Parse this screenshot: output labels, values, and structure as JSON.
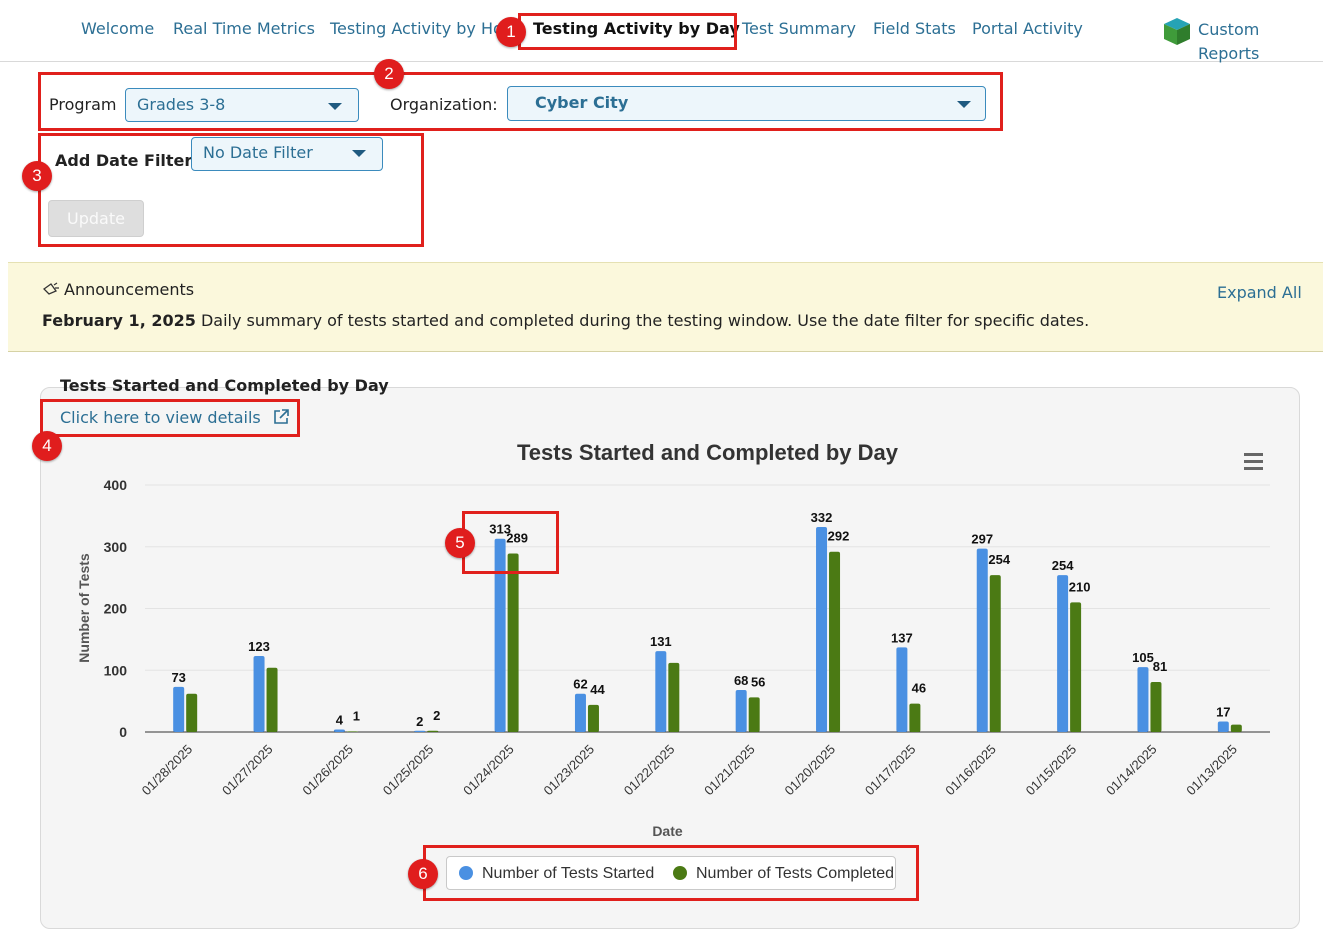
{
  "nav": {
    "items": [
      {
        "label": "Welcome"
      },
      {
        "label": "Real Time Metrics"
      },
      {
        "label": "Testing Activity by Ho"
      },
      {
        "label": "Testing Activity by Day",
        "active": true
      },
      {
        "label": "Test Summary"
      },
      {
        "label": "Field Stats"
      },
      {
        "label": "Portal Activity"
      }
    ],
    "custom_reports": {
      "line1": "Custom",
      "line2": "Reports"
    }
  },
  "filters": {
    "program_label": "Program",
    "program_value": "Grades 3-8",
    "organization_label": "Organization:",
    "organization_value": "Cyber City",
    "date_filter_label": "Add Date Filter",
    "date_filter_value": "No Date Filter",
    "update_button": "Update"
  },
  "annotations": [
    "1",
    "2",
    "3",
    "4",
    "5",
    "6"
  ],
  "announcements": {
    "title": "Announcements",
    "expand_all": "Expand All",
    "date": "February 1, 2025",
    "message": "Daily summary of tests started and completed during the testing window. Use the date filter for specific dates."
  },
  "chart_section": {
    "heading": "Tests Started and Completed by Day",
    "details_link": "Click here to view details"
  },
  "colors": {
    "accent": "#2c6f94",
    "started": "#4a90e2",
    "completed": "#4b7a14",
    "annotation": "#e0201c"
  },
  "chart_data": {
    "type": "bar",
    "title": "Tests Started and Completed by Day",
    "xlabel": "Date",
    "ylabel": "Number of Tests",
    "ylim": [
      0,
      400
    ],
    "yticks": [
      0,
      100,
      200,
      300,
      400
    ],
    "grid": true,
    "legend_position": "bottom-center",
    "categories": [
      "01/28/2025",
      "01/27/2025",
      "01/26/2025",
      "01/25/2025",
      "01/24/2025",
      "01/23/2025",
      "01/22/2025",
      "01/21/2025",
      "01/20/2025",
      "01/17/2025",
      "01/16/2025",
      "01/15/2025",
      "01/14/2025",
      "01/13/2025"
    ],
    "series": [
      {
        "name": "Number of Tests Started",
        "values": [
          73,
          123,
          4,
          2,
          313,
          62,
          131,
          68,
          332,
          137,
          297,
          254,
          105,
          17
        ],
        "labels": [
          "73",
          "123",
          "4",
          "2",
          "313",
          "62",
          "131",
          "68",
          "332",
          "137",
          "297",
          "254",
          "105",
          "17"
        ]
      },
      {
        "name": "Number of Tests Completed",
        "values": [
          62,
          104,
          1,
          2,
          289,
          44,
          112,
          56,
          292,
          46,
          254,
          210,
          81,
          12
        ],
        "labels": [
          "",
          "",
          "1",
          "2",
          "289",
          "44",
          "",
          "56",
          "292",
          "46",
          "254",
          "210",
          "81",
          ""
        ]
      }
    ]
  }
}
